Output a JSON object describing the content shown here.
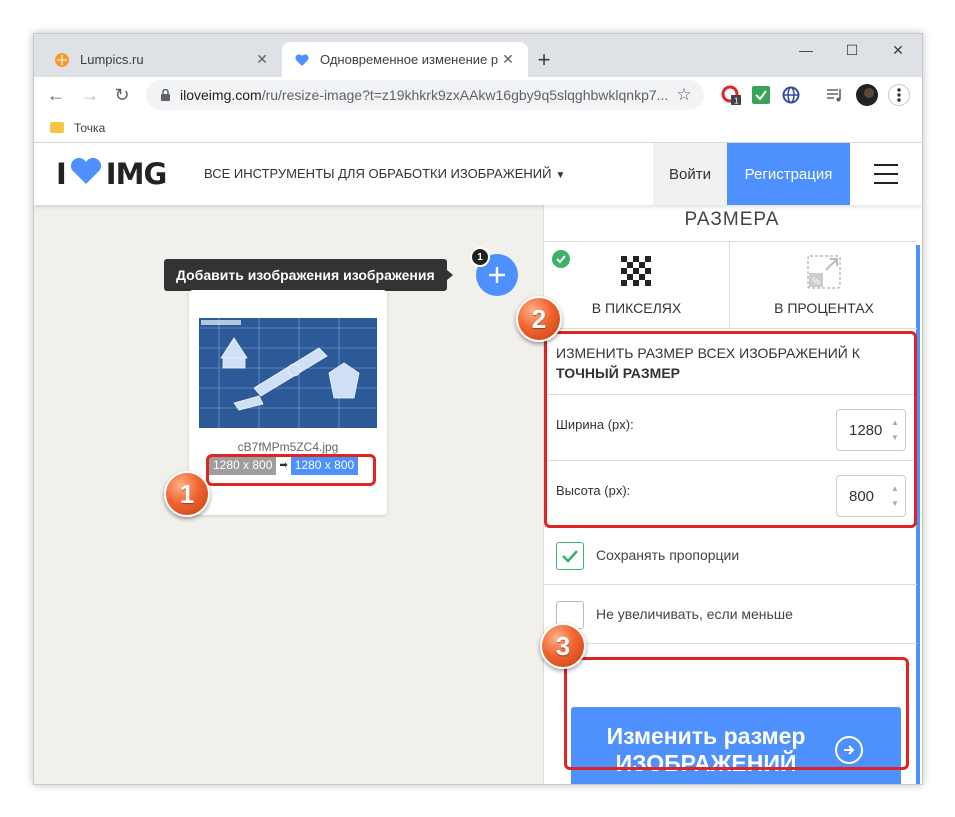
{
  "browser": {
    "tabs": [
      {
        "title": "Lumpics.ru",
        "active": false
      },
      {
        "title": "Одновременное изменение ра",
        "active": true
      }
    ],
    "url_host": "iloveimg.com",
    "url_path": "/ru/resize-image?t=z19khkrk9zxAAkw16gby9q5slqghbwklqnkp7...",
    "bookmark": "Точка",
    "extension_badge": "1"
  },
  "site": {
    "logo_left": "I",
    "logo_right": "IMG",
    "tools_menu": "ВСЕ ИНСТРУМЕНТЫ ДЛЯ ОБРАБОТКИ ИЗОБРАЖЕНИЙ",
    "login": "Войти",
    "signup": "Регистрация",
    "brand_color": "#4d90fe"
  },
  "workspace": {
    "add_tooltip": "Добавить изображения изображения",
    "add_count": "1",
    "file_name": "cB7fMPm5ZC4.jpg",
    "original_dims": "1280 x 800",
    "new_dims": "1280 x 800"
  },
  "sidebar": {
    "title": "РАЗМЕРА",
    "mode_pixels": "В ПИКСЕЛЯХ",
    "mode_percent": "В ПРОЦЕНТАХ",
    "resize_all_prefix": "ИЗМЕНИТЬ РАЗМЕР ВСЕХ ИЗОБРАЖЕНИЙ К",
    "resize_all_mode": "ТОЧНЫЙ РАЗМЕР",
    "width_label": "Ширина (px):",
    "width_value": "1280",
    "height_label": "Высота (px):",
    "height_value": "800",
    "keep_ratio_label": "Сохранять пропорции",
    "keep_ratio_checked": true,
    "no_enlarge_label": "Не увеличивать, если меньше",
    "no_enlarge_checked": false,
    "cta_line1": "Изменить размер",
    "cta_line2": "ИЗОБРАЖЕНИЙ"
  },
  "annotations": {
    "markers": [
      "1",
      "2",
      "3"
    ]
  }
}
